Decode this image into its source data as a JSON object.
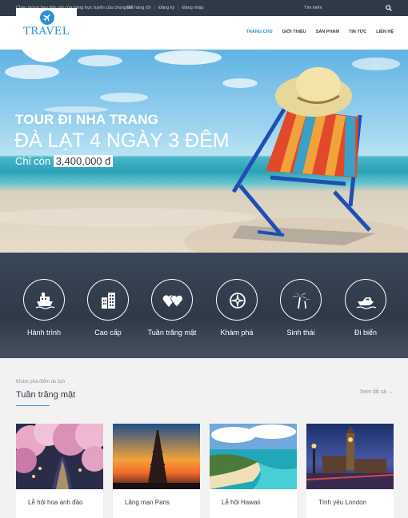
{
  "topbar": {
    "welcome": "Chào mừng bạn đến với cửa hàng trực tuyến của chúng tôi!",
    "cart": "Giỏ hàng (0)",
    "register": "Đăng ký",
    "login": "Đăng nhập",
    "search_placeholder": "Tìm kiếm",
    "search_icon": "search-icon"
  },
  "logo": {
    "text": "TRAVEL",
    "icon": "airplane-icon"
  },
  "menu": [
    "TRANG CHỦ",
    "GIỚI THIỆU",
    "SẢN PHẨM",
    "TIN TỨC",
    "LIÊN HỆ"
  ],
  "hero": {
    "line1": "TOUR ĐI NHA TRANG",
    "line2": "ĐÀ LẠT 4 NGÀY 3 ĐÊM",
    "price_prefix": "Chỉ còn",
    "price": "3,400,000 đ"
  },
  "features": [
    {
      "label": "Hành trình",
      "icon": "ship-icon"
    },
    {
      "label": "Cao cấp",
      "icon": "buildings-icon"
    },
    {
      "label": "Tuần trăng mật",
      "icon": "hearts-icon"
    },
    {
      "label": "Khám phá",
      "icon": "compass-icon"
    },
    {
      "label": "Sinh thái",
      "icon": "palm-trees-icon"
    },
    {
      "label": "Đi biển",
      "icon": "speedboat-icon"
    }
  ],
  "section": {
    "kicker": "Khám phá điểm du lịch",
    "title": "Tuần trăng mật",
    "view_all": "Xem tất cả"
  },
  "cards": [
    {
      "title": "Lễ hội hoa anh đào"
    },
    {
      "title": "Lãng mạn Paris"
    },
    {
      "title": "Lễ hội Hawaii"
    },
    {
      "title": "Tình yêu London"
    }
  ],
  "colors": {
    "accent": "#2b8fd6",
    "dark": "#2f3a48",
    "white": "#ffffff"
  }
}
